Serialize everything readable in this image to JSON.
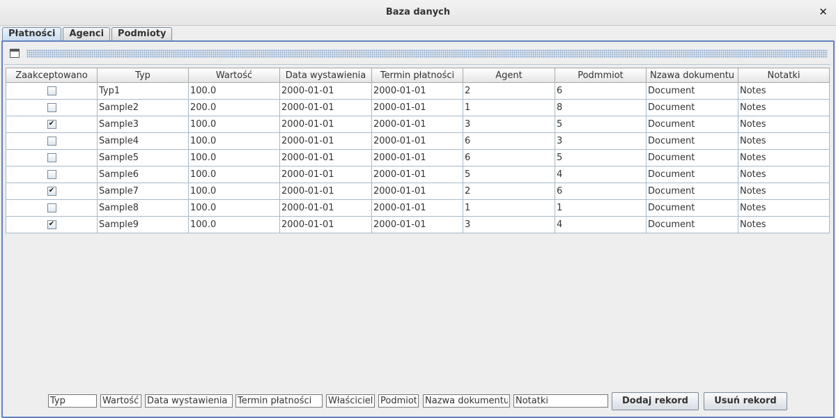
{
  "window": {
    "title": "Baza danych",
    "close_glyph": "✕"
  },
  "tabs": [
    {
      "label": "Płatności",
      "active": true
    },
    {
      "label": "Agenci",
      "active": false
    },
    {
      "label": "Podmioty",
      "active": false
    }
  ],
  "table": {
    "columns": [
      "Zaakceptowano",
      "Typ",
      "Wartość",
      "Data wystawienia",
      "Termin płatności",
      "Agent",
      "Podmmiot",
      "Nzawa dokumentu",
      "Notatki"
    ],
    "rows": [
      {
        "accepted": false,
        "typ": "Typ1",
        "wartosc": "100.0",
        "data": "2000-01-01",
        "termin": "2000-01-01",
        "agent": "2",
        "podmiot": "6",
        "dokument": "Document",
        "notatki": "Notes"
      },
      {
        "accepted": false,
        "typ": "Sample2",
        "wartosc": "200.0",
        "data": "2000-01-01",
        "termin": "2000-01-01",
        "agent": "1",
        "podmiot": "8",
        "dokument": "Document",
        "notatki": "Notes"
      },
      {
        "accepted": true,
        "typ": "Sample3",
        "wartosc": "100.0",
        "data": "2000-01-01",
        "termin": "2000-01-01",
        "agent": "3",
        "podmiot": "5",
        "dokument": "Document",
        "notatki": "Notes"
      },
      {
        "accepted": false,
        "typ": "Sample4",
        "wartosc": "100.0",
        "data": "2000-01-01",
        "termin": "2000-01-01",
        "agent": "6",
        "podmiot": "3",
        "dokument": "Document",
        "notatki": "Notes"
      },
      {
        "accepted": false,
        "typ": "Sample5",
        "wartosc": "100.0",
        "data": "2000-01-01",
        "termin": "2000-01-01",
        "agent": "6",
        "podmiot": "5",
        "dokument": "Document",
        "notatki": "Notes"
      },
      {
        "accepted": false,
        "typ": "Sample6",
        "wartosc": "100.0",
        "data": "2000-01-01",
        "termin": "2000-01-01",
        "agent": "5",
        "podmiot": "4",
        "dokument": "Document",
        "notatki": "Notes"
      },
      {
        "accepted": true,
        "typ": "Sample7",
        "wartosc": "100.0",
        "data": "2000-01-01",
        "termin": "2000-01-01",
        "agent": "2",
        "podmiot": "6",
        "dokument": "Document",
        "notatki": "Notes"
      },
      {
        "accepted": false,
        "typ": "Sample8",
        "wartosc": "100.0",
        "data": "2000-01-01",
        "termin": "2000-01-01",
        "agent": "1",
        "podmiot": "1",
        "dokument": "Document",
        "notatki": "Notes"
      },
      {
        "accepted": true,
        "typ": "Sample9",
        "wartosc": "100.0",
        "data": "2000-01-01",
        "termin": "2000-01-01",
        "agent": "3",
        "podmiot": "4",
        "dokument": "Document",
        "notatki": "Notes"
      }
    ]
  },
  "form": {
    "typ": "Typ",
    "wartosc": "Wartość",
    "data": "Data wystawienia",
    "termin": "Termin płatności",
    "wlasciciel": "Właściciel",
    "podmiot": "Podmiot",
    "dokument": "Nazwa dokumentu",
    "notatki": "Notatki",
    "add_label": "Dodaj rekord",
    "remove_label": "Usuń rekord"
  },
  "colors": {
    "accent": "#6382bf",
    "checkmark": "✔"
  }
}
